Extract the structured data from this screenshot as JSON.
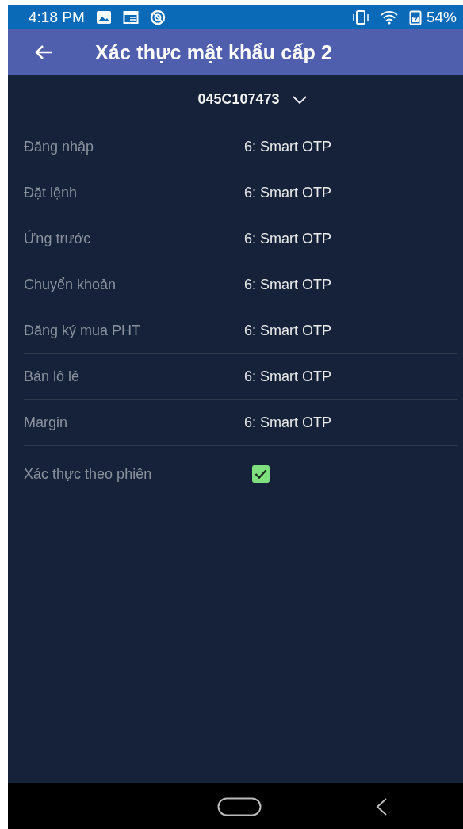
{
  "status_bar": {
    "time": "4:18 PM",
    "battery": "54%"
  },
  "app_bar": {
    "title": "Xác thực mật khẩu cấp 2"
  },
  "account": {
    "value": "045C107473"
  },
  "settings": [
    {
      "kind": "value",
      "label": "Đăng nhập",
      "value": "6: Smart OTP"
    },
    {
      "kind": "value",
      "label": "Đặt lệnh",
      "value": "6: Smart OTP"
    },
    {
      "kind": "value",
      "label": "Ứng trước",
      "value": "6: Smart OTP"
    },
    {
      "kind": "value",
      "label": "Chuyển khoản",
      "value": "6: Smart OTP"
    },
    {
      "kind": "value",
      "label": "Đăng ký mua PHT",
      "value": "6: Smart OTP"
    },
    {
      "kind": "value",
      "label": "Bán lô lẻ",
      "value": "6: Smart OTP"
    },
    {
      "kind": "value",
      "label": "Margin",
      "value": "6: Smart OTP"
    },
    {
      "kind": "checkbox",
      "label": "Xác thực theo phiên",
      "checked": true
    }
  ]
}
